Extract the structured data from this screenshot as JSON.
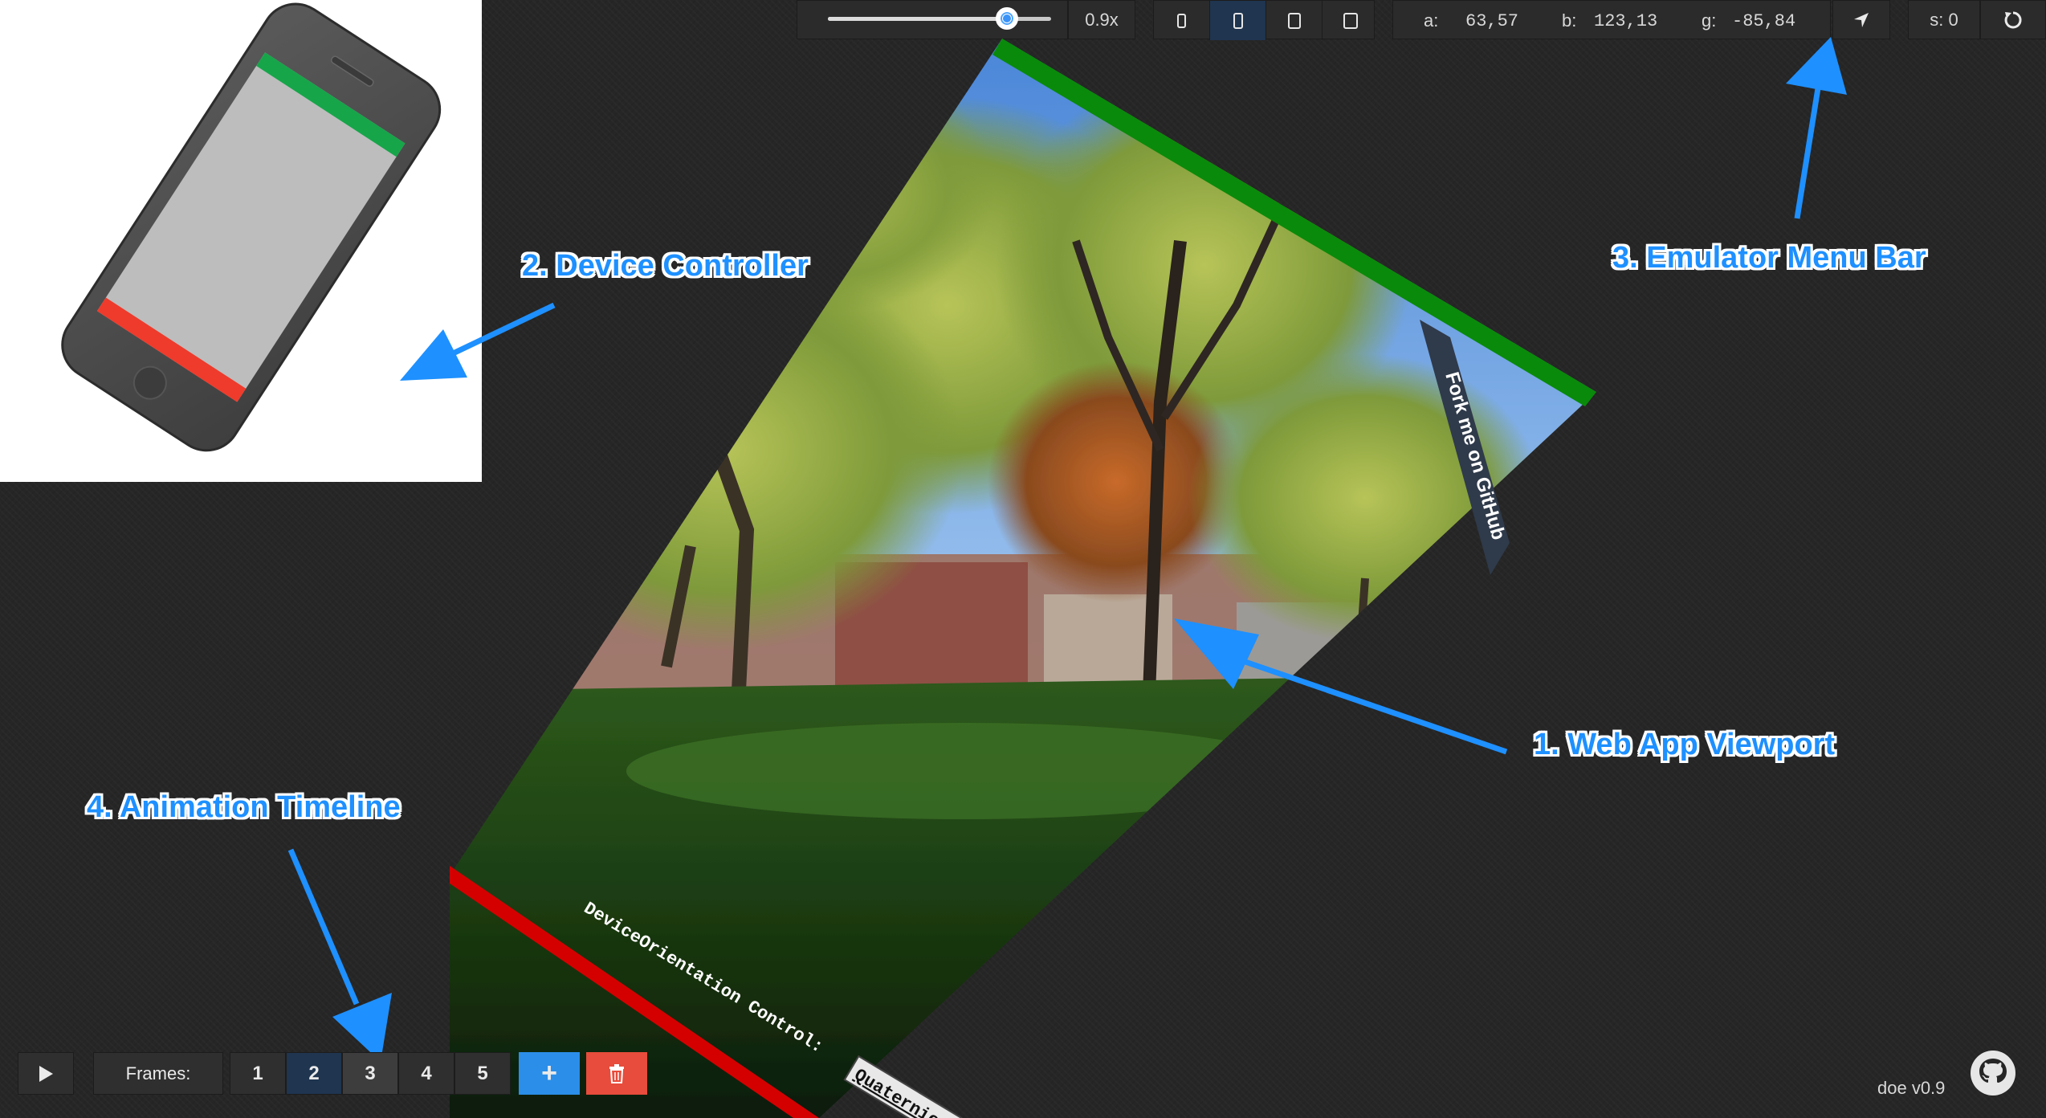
{
  "menu": {
    "zoom_label": "0.9x",
    "zoom_level": 0.9,
    "orientation": {
      "alpha_label": "a:",
      "alpha_value": "63,57",
      "beta_label": "b:",
      "beta_value": "123,13",
      "gamma_label": "g:",
      "gamma_value": "-85,84"
    },
    "screen_label": "s: 0",
    "devices": [
      "phone-small-icon",
      "phone-icon",
      "tablet-small-icon",
      "tablet-icon"
    ],
    "active_device_index": 1
  },
  "viewport": {
    "ribbon_text": "Fork me on GitHub",
    "control_text": "DeviceOrientation Control:",
    "control_button_label": "Quaternion"
  },
  "timeline": {
    "frames_label": "Frames:",
    "frames": [
      "1",
      "2",
      "3",
      "4",
      "5"
    ],
    "active_frame_index": 1,
    "add_label": "+"
  },
  "annotations": {
    "viewport": "1. Web App Viewport",
    "controller": "2. Device Controller",
    "menu_bar": "3. Emulator Menu Bar",
    "timeline": "4. Animation Timeline"
  },
  "footer": {
    "version": "doe v0.9"
  },
  "colors": {
    "accent_blue": "#3b93f7",
    "add_button": "#2b8ee8",
    "delete_button": "#e74c3c",
    "top_bar_green": "#0a8a0a",
    "bottom_bar_red": "#d40000",
    "annotation_blue": "#1e90ff"
  }
}
